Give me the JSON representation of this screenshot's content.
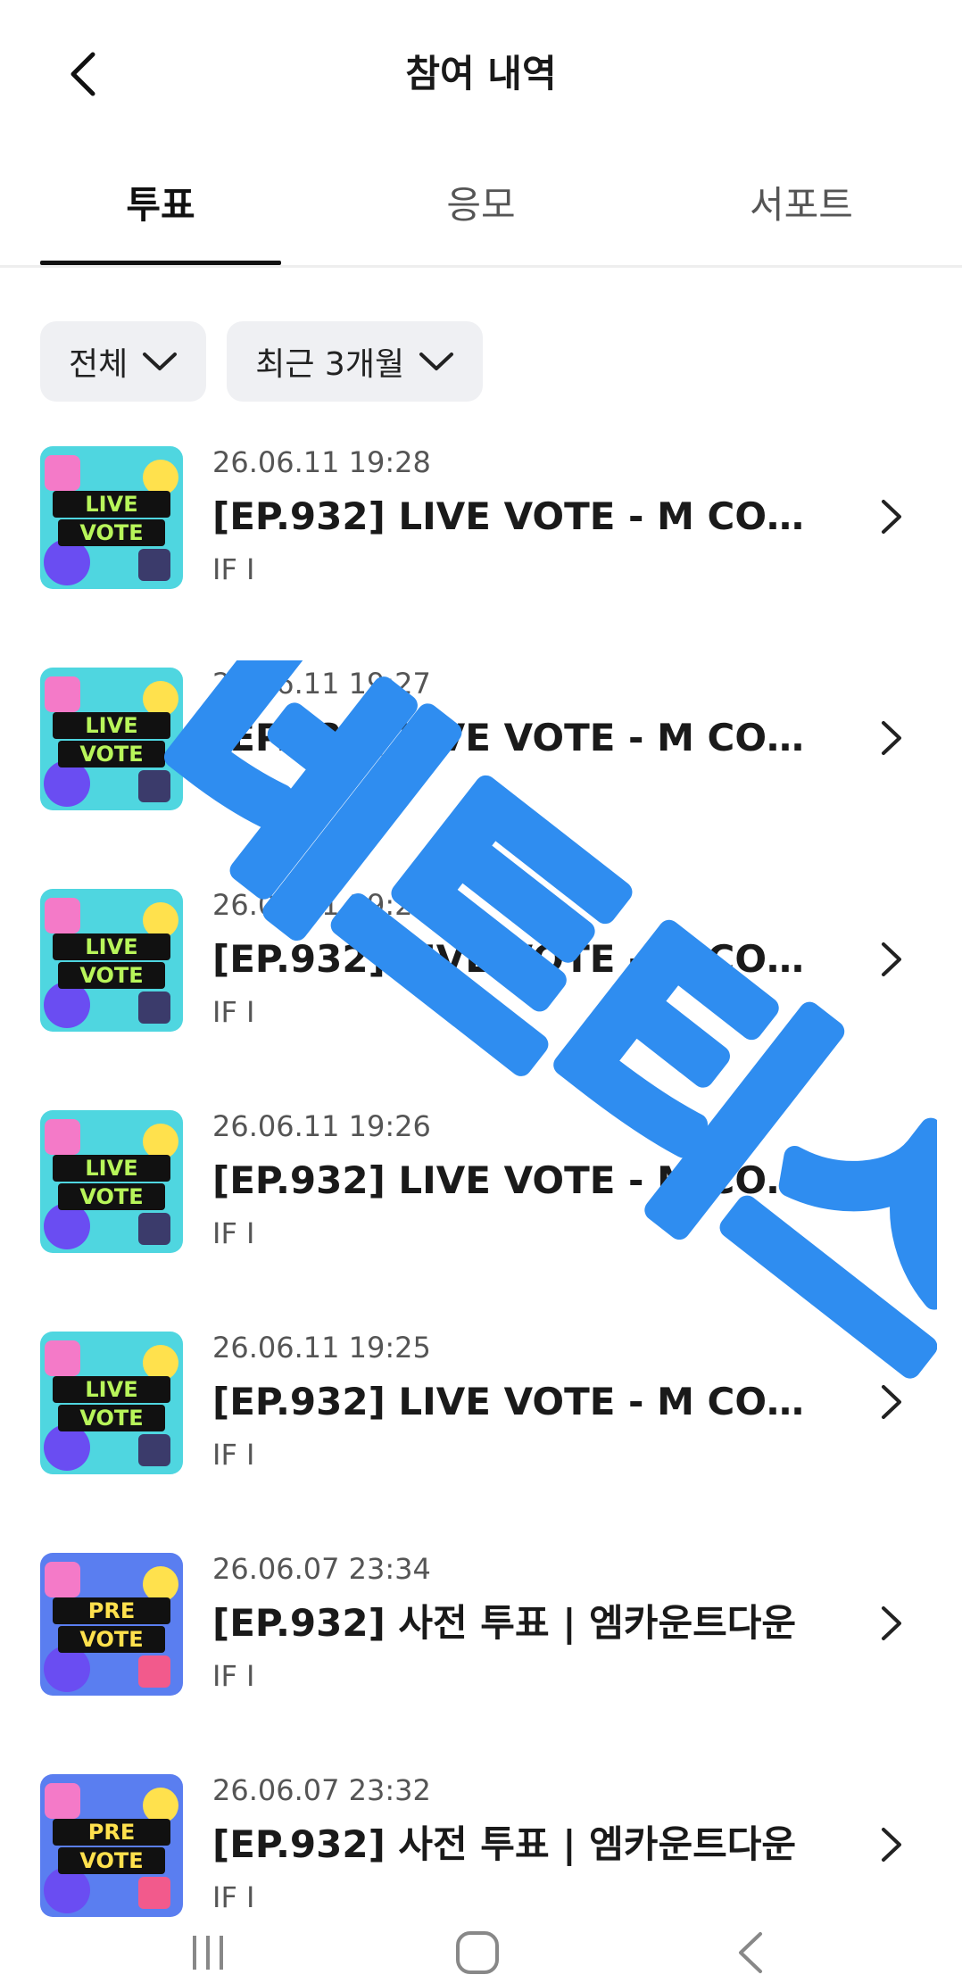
{
  "header": {
    "title": "참여 내역"
  },
  "tabs": [
    {
      "label": "투표",
      "active": true
    },
    {
      "label": "응모",
      "active": false
    },
    {
      "label": "서포트",
      "active": false
    }
  ],
  "filters": [
    {
      "label": "전체"
    },
    {
      "label": "최근 3개월"
    }
  ],
  "items": [
    {
      "date": "26.06.11 19:28",
      "title": "[EP.932] LIVE VOTE - M COUN...",
      "sub": "IF I",
      "thumb": "LIVE VOTE"
    },
    {
      "date": "26.06.11 19:27",
      "title": "[EP.932] LIVE VOTE - M COUN...",
      "sub": "IF I",
      "thumb": "LIVE VOTE"
    },
    {
      "date": "26.06.11 19:26",
      "title": "[EP.932] LIVE VOTE - M COUN...",
      "sub": "IF I",
      "thumb": "LIVE VOTE"
    },
    {
      "date": "26.06.11 19:26",
      "title": "[EP.932] LIVE VOTE - M COUN...",
      "sub": "IF I",
      "thumb": "LIVE VOTE"
    },
    {
      "date": "26.06.11 19:25",
      "title": "[EP.932] LIVE VOTE - M COUN...",
      "sub": "IF I",
      "thumb": "LIVE VOTE"
    },
    {
      "date": "26.06.07 23:34",
      "title": "[EP.932] 사전 투표 | 엠카운트다운",
      "sub": "IF I",
      "thumb": "PRE VOTE"
    },
    {
      "date": "26.06.07 23:32",
      "title": "[EP.932] 사전 투표 | 엠카운트다운",
      "sub": "IF I",
      "thumb": "PRE VOTE"
    }
  ],
  "watermark": "네트티스",
  "icons": {
    "back": "chevron-left-icon",
    "filter_dropdown": "chevron-down-icon",
    "row_arrow": "chevron-right-icon",
    "nav_recents": "recents-icon",
    "nav_home": "home-icon",
    "nav_back": "back-icon"
  },
  "colors": {
    "live_thumb_bg": "#4fd6e0",
    "pre_thumb_bg": "#5a7ef0",
    "chip_bg": "#eff0f3",
    "watermark": "#2f8df0"
  }
}
